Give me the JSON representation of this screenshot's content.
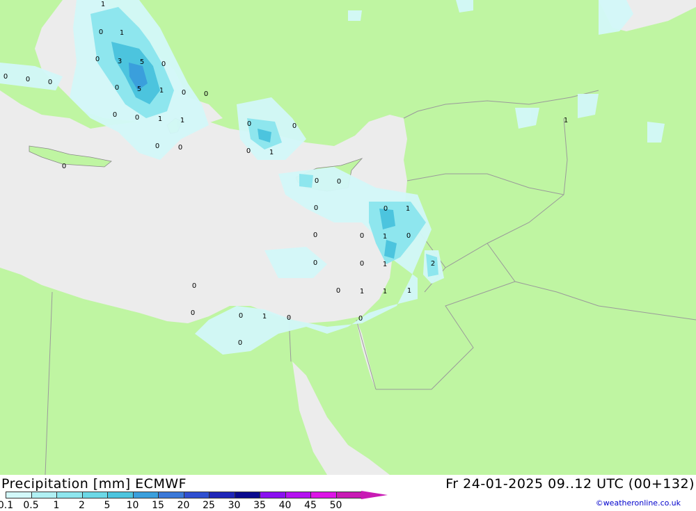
{
  "title": {
    "left": "Precipitation [mm] ECMWF",
    "right": "Fr 24-01-2025 09..12 UTC (00+132)"
  },
  "credit": "©weatheronline.co.uk",
  "colors": {
    "land": "#bff5a2",
    "sea": "#ececec",
    "border": "#9a9a9a"
  },
  "legend": {
    "ticks": [
      "0.1",
      "0.5",
      "1",
      "2",
      "5",
      "10",
      "15",
      "20",
      "25",
      "30",
      "35",
      "40",
      "45",
      "50"
    ],
    "swatches": [
      "#d3f8f9",
      "#b0f0f3",
      "#8ee6ee",
      "#6cd8e6",
      "#4cc4de",
      "#3a9fdc",
      "#3a78d8",
      "#2f4fd0",
      "#1f26b8",
      "#0a0a8e",
      "#8a10f0",
      "#b412f0",
      "#dc14e6",
      "#c81ab4"
    ]
  },
  "map_labels": [
    "1",
    "0",
    "1",
    "0",
    "3",
    "5",
    "0",
    "0",
    "0",
    "0",
    "0",
    "5",
    "1",
    "0",
    "0",
    "0",
    "1",
    "1",
    "0",
    "0",
    "0",
    "0",
    "0",
    "0",
    "1",
    "0",
    "0",
    "0",
    "0",
    "1",
    "0",
    "1",
    "0",
    "0",
    "1",
    "1",
    "1",
    "2",
    "0",
    "1",
    "0",
    "1",
    "0",
    "0",
    "0",
    "0",
    "1",
    "0",
    "0",
    "0",
    "0"
  ]
}
